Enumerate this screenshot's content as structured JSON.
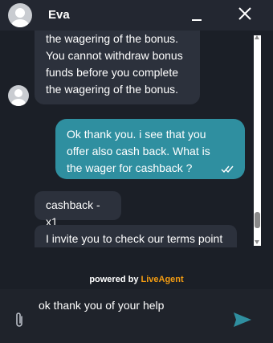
{
  "header": {
    "agent_name": "Eva",
    "avatar_icon": "user-avatar-icon",
    "minimize_icon": "minimize-icon",
    "close_icon": "close-icon"
  },
  "messages": [
    {
      "sender": "agent",
      "lines": [
        "the wagering of the bonus.",
        "You cannot withdraw bonus",
        "funds before you complete",
        "the wagering of the bonus."
      ]
    },
    {
      "sender": "visitor",
      "lines": [
        "Ok thank you. i see that you",
        "offer also cash back. What is",
        "the wager for cashback ?"
      ],
      "status_icon": "double-check-icon"
    },
    {
      "sender": "agent",
      "lines": [
        "cashback -x1"
      ]
    },
    {
      "sender": "agent",
      "lines": [
        "I invite you to check our terms point"
      ]
    }
  ],
  "footer": {
    "powered_prefix": "powered by ",
    "powered_brand": "LiveAgent"
  },
  "composer": {
    "value": "ok thank you of your help",
    "attach_icon": "paperclip-icon",
    "send_icon": "send-icon"
  },
  "colors": {
    "background": "#1b1f27",
    "header": "#232731",
    "agent_bubble": "#2c313c",
    "visitor_bubble": "#2f8fa0",
    "brand": "#f39c12",
    "send": "#2f8fa0"
  }
}
